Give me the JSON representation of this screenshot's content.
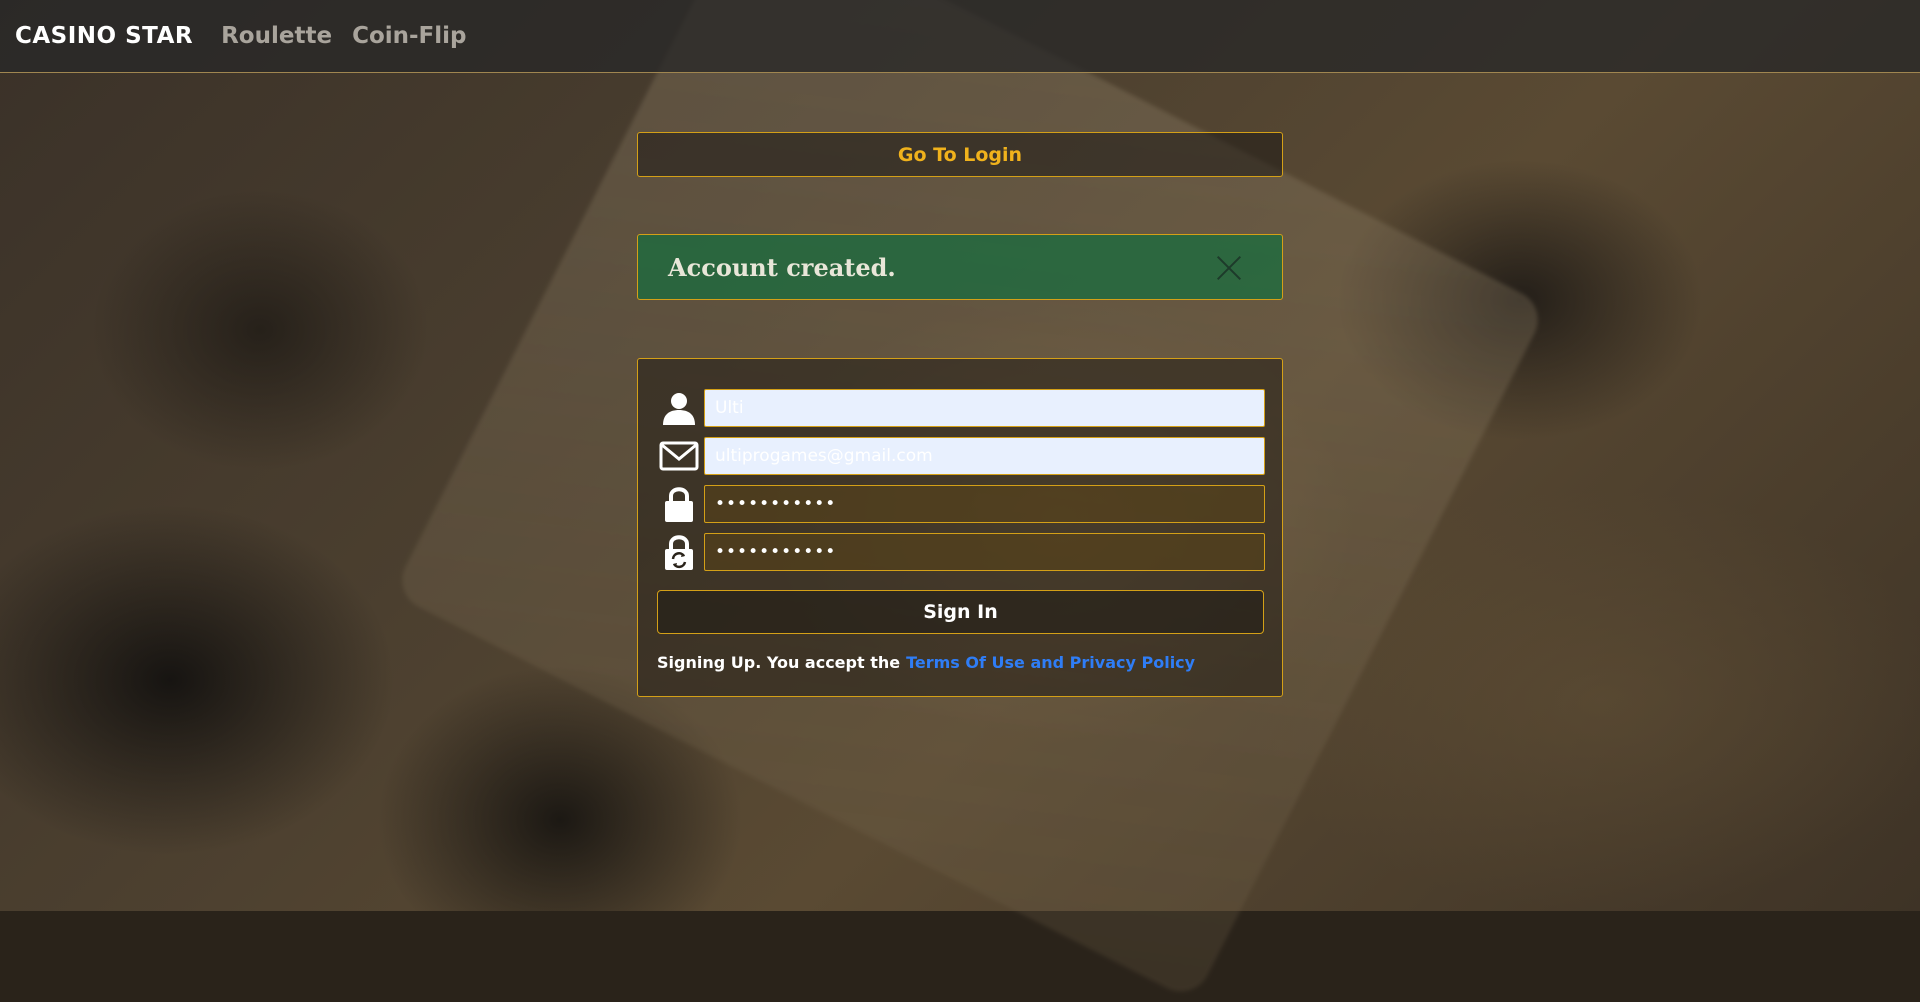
{
  "nav": {
    "brand": "CASINO STAR",
    "links": [
      "Roulette",
      "Coin-Flip"
    ]
  },
  "goto_login": "Go To Login",
  "alert": {
    "message": "Account created.",
    "close_icon": "close-icon",
    "color": "#166e3e"
  },
  "form": {
    "username": {
      "icon": "user-icon",
      "value": "Ulti"
    },
    "email": {
      "icon": "envelope-icon",
      "value": "ultiprogames@gmail.com"
    },
    "password": {
      "icon": "lock-icon",
      "value": "•••••••••••"
    },
    "confirm_password": {
      "icon": "lock-refresh-icon",
      "value": "•••••••••••"
    },
    "submit_label": "Sign In",
    "terms_prefix": "Signing Up. You accept the",
    "terms_link": "Terms Of Use and Privacy Policy"
  },
  "colors": {
    "accent": "#d4a017",
    "link": "#2f7df6",
    "goto_text": "#f0b21c"
  }
}
